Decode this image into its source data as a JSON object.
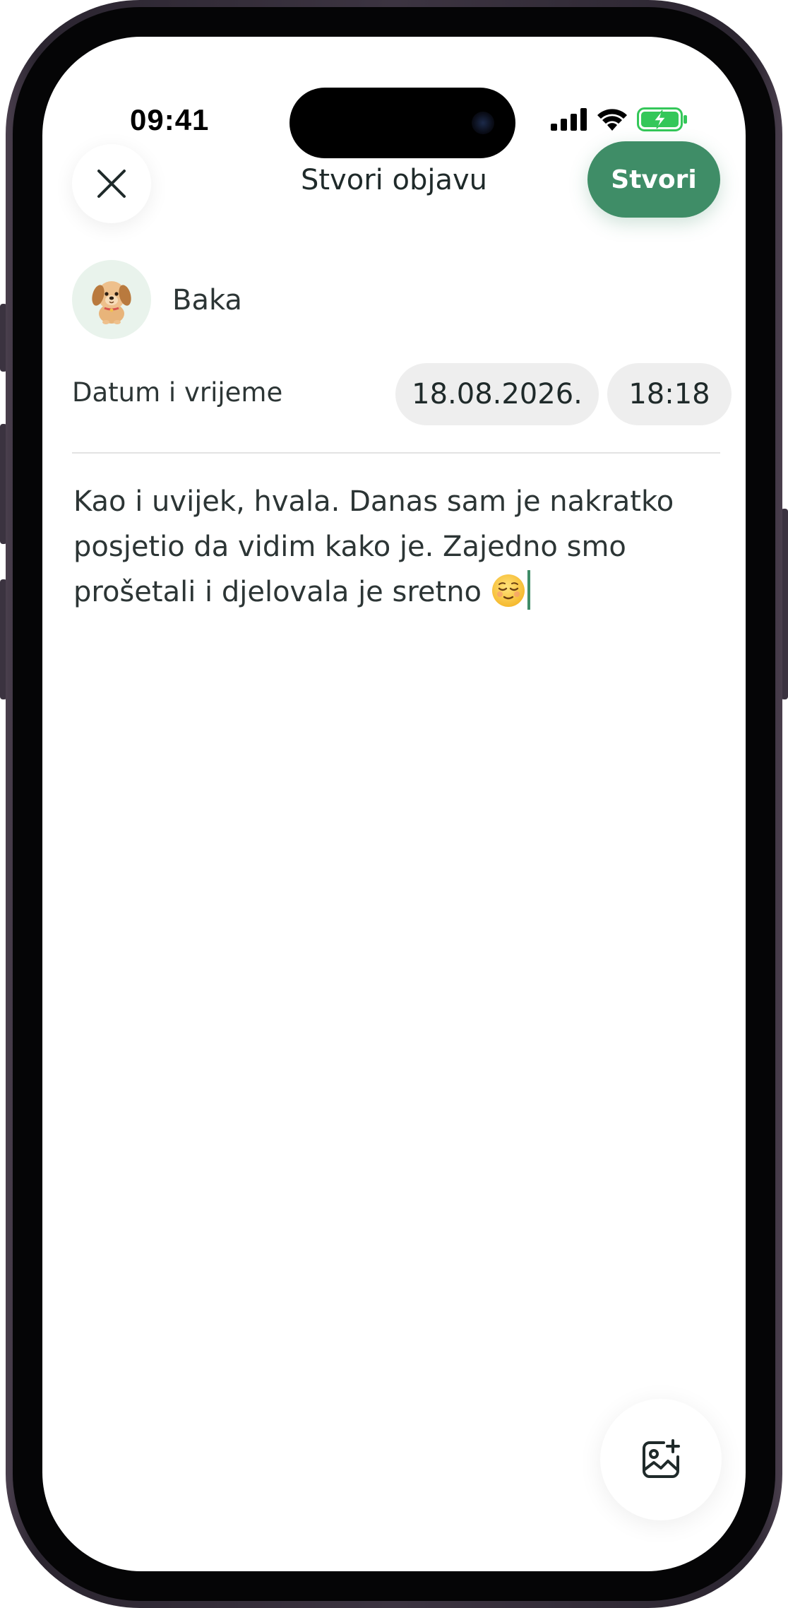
{
  "status_bar": {
    "time": "09:41",
    "icons": [
      "signal-icon",
      "wifi-icon",
      "battery-charging-icon"
    ]
  },
  "header": {
    "title": "Stvori objavu",
    "close_icon": "close-icon",
    "create_label": "Stvori"
  },
  "profile": {
    "name": "Baka",
    "avatar_icon": "dog-avatar-icon"
  },
  "datetime": {
    "label": "Datum i vrijeme",
    "date": "18.08.2026.",
    "time": "18:18"
  },
  "post": {
    "text": "Kao i uvijek, hvala. Danas sam je nakratko posjetio da vidim kako je. Zajedno smo prošetali i djelovala je sretno",
    "emoji": "relieved-face-emoji"
  },
  "media_button": {
    "icon": "add-image-icon"
  },
  "colors": {
    "accent": "#3f8d67",
    "pill_bg": "#eeeeee",
    "avatar_bg": "#e9f3ec",
    "text": "#1f2a2a"
  }
}
